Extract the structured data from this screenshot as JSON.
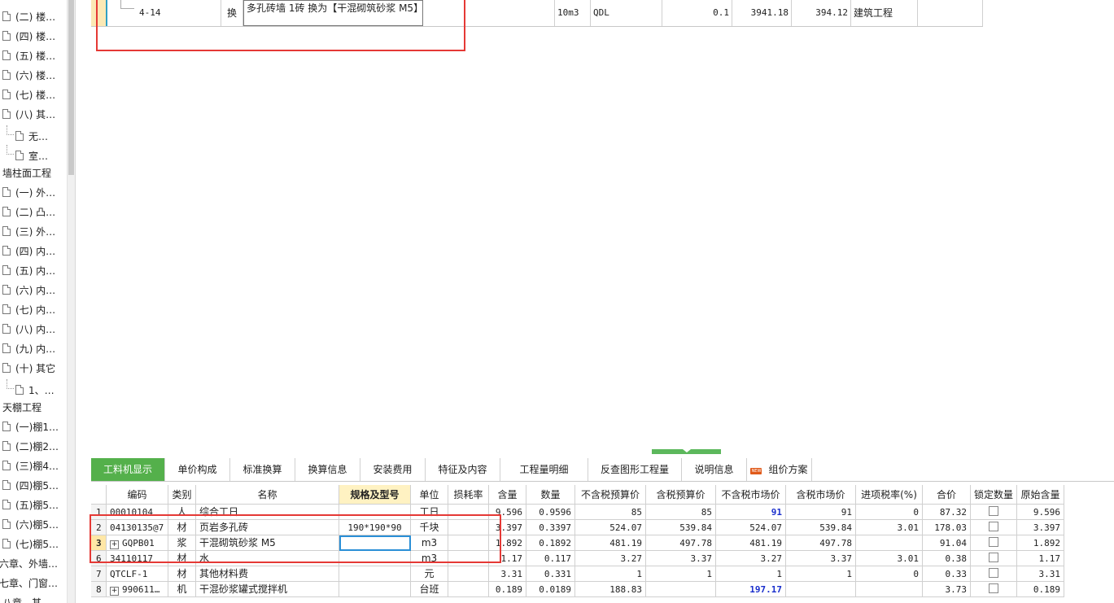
{
  "tree": {
    "items": [
      {
        "label": "(二) 楼…",
        "type": "doc"
      },
      {
        "label": "(四) 楼…",
        "type": "doc"
      },
      {
        "label": "(五) 楼…",
        "type": "doc"
      },
      {
        "label": "(六) 楼…",
        "type": "doc"
      },
      {
        "label": "(七) 楼…",
        "type": "doc"
      },
      {
        "label": "(八) 其…",
        "type": "doc"
      },
      {
        "label": "无…",
        "type": "child"
      },
      {
        "label": "室…",
        "type": "child"
      },
      {
        "label": "墙柱面工程",
        "type": "heading"
      },
      {
        "label": "(一) 外…",
        "type": "doc"
      },
      {
        "label": "(二) 凸…",
        "type": "doc"
      },
      {
        "label": "(三) 外…",
        "type": "doc"
      },
      {
        "label": "(四) 内…",
        "type": "doc"
      },
      {
        "label": "(五) 内…",
        "type": "doc"
      },
      {
        "label": "(六) 内…",
        "type": "doc"
      },
      {
        "label": "(七) 内…",
        "type": "doc"
      },
      {
        "label": "(八) 内…",
        "type": "doc"
      },
      {
        "label": "(九) 内…",
        "type": "doc"
      },
      {
        "label": "(十) 其它",
        "type": "doc"
      },
      {
        "label": "1、…",
        "type": "child"
      },
      {
        "label": "天棚工程",
        "type": "heading"
      },
      {
        "label": "(一)棚1…",
        "type": "doc"
      },
      {
        "label": "(二)棚2…",
        "type": "doc"
      },
      {
        "label": "(三)棚4…",
        "type": "doc"
      },
      {
        "label": "(四)棚5…",
        "type": "doc"
      },
      {
        "label": "(五)棚5…",
        "type": "doc"
      },
      {
        "label": "(六)棚5…",
        "type": "doc"
      },
      {
        "label": "(七)棚5…",
        "type": "doc"
      },
      {
        "label": "六章、外墙…",
        "type": "heading"
      },
      {
        "label": "七章、门窗…",
        "type": "heading"
      },
      {
        "label": "八章、其…",
        "type": "heading"
      }
    ]
  },
  "top_row": {
    "code": "4-14",
    "type": "换",
    "name": "多孔砖墙 1砖  换为【干混砌筑砂浆 M5】",
    "unit": "10m3",
    "expr": "QDL",
    "qty": "0.1",
    "price": "3941.18",
    "total": "394.12",
    "category": "建筑工程"
  },
  "tabs": [
    {
      "label": "工料机显示",
      "active": true
    },
    {
      "label": "单价构成"
    },
    {
      "label": "标准换算"
    },
    {
      "label": "换算信息"
    },
    {
      "label": "安装费用"
    },
    {
      "label": "特征及内容"
    },
    {
      "label": "工程量明细"
    },
    {
      "label": "反查图形工程量"
    },
    {
      "label": "说明信息"
    },
    {
      "label": "组价方案",
      "badge": "NEW"
    }
  ],
  "grid": {
    "headers": [
      "",
      "编码",
      "类别",
      "名称",
      "规格及型号",
      "单位",
      "损耗率",
      "含量",
      "数量",
      "不含税预算价",
      "含税预算价",
      "不含税市场价",
      "含税市场价",
      "进项税率(%)",
      "合价",
      "锁定数量",
      "原始含量"
    ],
    "rows": [
      {
        "num": "1",
        "code": "00010104",
        "cat": "人",
        "name": "综合工日",
        "spec": "",
        "unit": "工日",
        "loss": "",
        "content": "9.596",
        "qty": "0.9596",
        "p1": "85",
        "p2": "85",
        "p3": "91",
        "p4": "91",
        "tax": "0",
        "total": "87.32",
        "orig": "9.596"
      },
      {
        "num": "2",
        "code": "04130135@7",
        "cat": "材",
        "name": "页岩多孔砖",
        "spec": "190*190*90",
        "unit": "千块",
        "loss": "",
        "content": "3.397",
        "qty": "0.3397",
        "p1": "524.07",
        "p2": "539.84",
        "p3": "524.07",
        "p4": "539.84",
        "tax": "3.01",
        "total": "178.03",
        "orig": "3.397"
      },
      {
        "num": "3",
        "code": "GQPB01",
        "cat": "浆",
        "name": "干混砌筑砂浆 M5",
        "spec": "",
        "unit": "m3",
        "loss": "",
        "content": "1.892",
        "qty": "0.1892",
        "p1": "481.19",
        "p2": "497.78",
        "p3": "481.19",
        "p4": "497.78",
        "tax": "",
        "total": "91.04",
        "orig": "1.892"
      },
      {
        "num": "6",
        "code": "34110117",
        "cat": "材",
        "name": "水",
        "spec": "",
        "unit": "m3",
        "loss": "",
        "content": "1.17",
        "qty": "0.117",
        "p1": "3.27",
        "p2": "3.37",
        "p3": "3.27",
        "p4": "3.37",
        "tax": "3.01",
        "total": "0.38",
        "orig": "1.17"
      },
      {
        "num": "7",
        "code": "QTCLF-1",
        "cat": "材",
        "name": "其他材料费",
        "spec": "",
        "unit": "元",
        "loss": "",
        "content": "3.31",
        "qty": "0.331",
        "p1": "1",
        "p2": "1",
        "p3": "1",
        "p4": "1",
        "tax": "0",
        "total": "0.33",
        "orig": "3.31"
      },
      {
        "num": "8",
        "code": "990611…",
        "cat": "机",
        "name": "干混砂浆罐式搅拌机",
        "spec": "",
        "unit": "台班",
        "loss": "",
        "content": "0.189",
        "qty": "0.0189",
        "p1": "188.83",
        "p2": "",
        "p3": "197.17",
        "p4": "",
        "tax": "",
        "total": "3.73",
        "orig": "0.189"
      }
    ]
  }
}
